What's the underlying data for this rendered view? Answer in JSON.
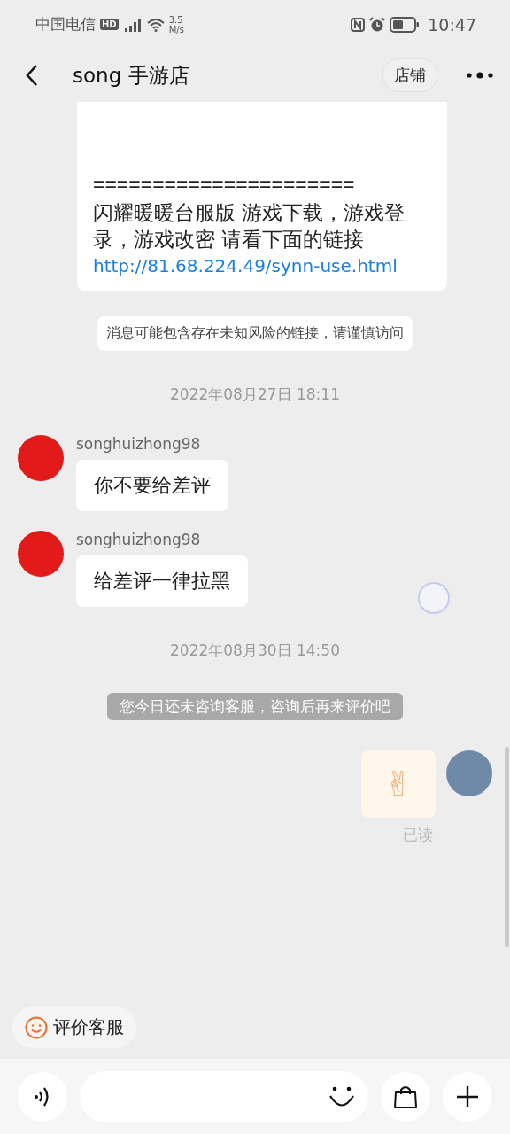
{
  "status_bar": {
    "carrier": "中国电信",
    "hd_badge": "HD",
    "speed_value": "3.5",
    "speed_unit": "M/s",
    "time": "10:47"
  },
  "header": {
    "title": "song 手游店",
    "shop_button": "店铺"
  },
  "messages": [
    {
      "kind": "card",
      "divider": "======================",
      "paragraph": "闪耀暖暖台服版 游戏下载，游戏登录，游戏改密 请看下面的链接",
      "link": "http://81.68.224.49/synn-use.html"
    },
    {
      "kind": "notice",
      "text": "消息可能包含存在未知风险的链接，请谨慎访问"
    },
    {
      "kind": "timestamp",
      "text": "2022年08月27日 18:11"
    },
    {
      "kind": "incoming",
      "sender": "songhuizhong98",
      "text": "你不要给差评"
    },
    {
      "kind": "incoming",
      "sender": "songhuizhong98",
      "text": "给差评一律拉黑"
    },
    {
      "kind": "timestamp",
      "text": "2022年08月30日 14:50"
    },
    {
      "kind": "system",
      "text": "您今日还未咨询客服，咨询后再来评价吧"
    },
    {
      "kind": "outgoing",
      "emoji": "✌",
      "read_status": "已读"
    }
  ],
  "rate_button": "评价客服"
}
